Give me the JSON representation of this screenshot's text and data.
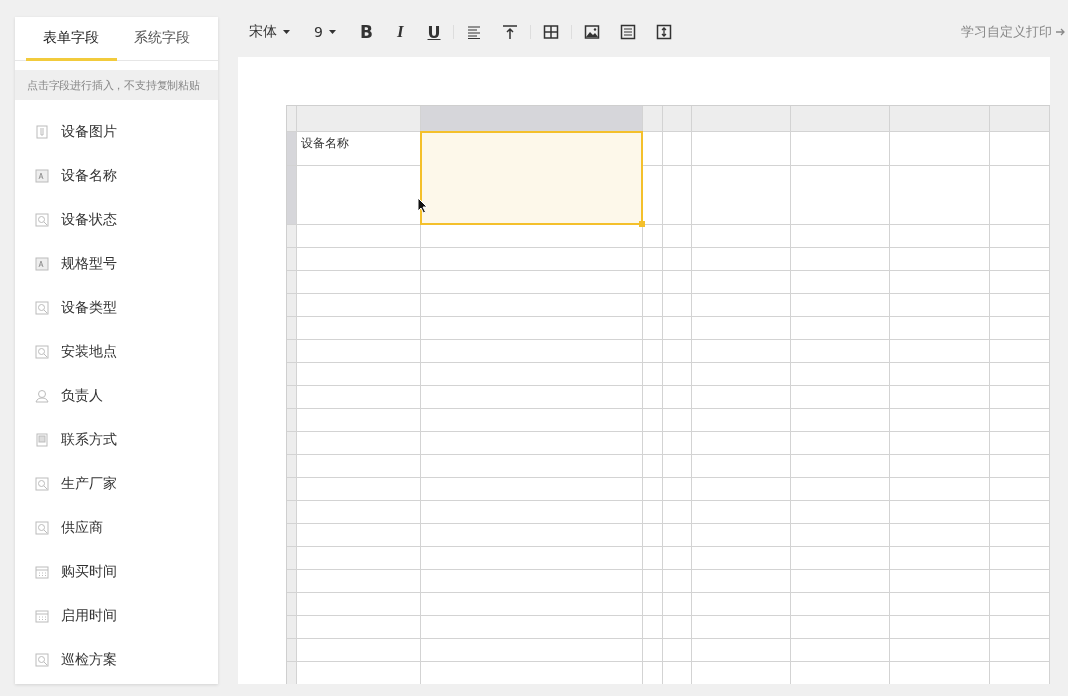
{
  "sidebar": {
    "tabs": [
      {
        "label": "表单字段",
        "selected": true
      },
      {
        "label": "系统字段",
        "selected": false
      }
    ],
    "hint": "点击字段进行插入，不支持复制粘贴",
    "items": [
      {
        "label": "设备图片",
        "kind": "file"
      },
      {
        "label": "设备名称",
        "kind": "text"
      },
      {
        "label": "设备状态",
        "kind": "lookup"
      },
      {
        "label": "规格型号",
        "kind": "text"
      },
      {
        "label": "设备类型",
        "kind": "lookup"
      },
      {
        "label": "安装地点",
        "kind": "lookup"
      },
      {
        "label": "负责人",
        "kind": "user"
      },
      {
        "label": "联系方式",
        "kind": "phone"
      },
      {
        "label": "生产厂家",
        "kind": "lookup"
      },
      {
        "label": "供应商",
        "kind": "lookup"
      },
      {
        "label": "购买时间",
        "kind": "date"
      },
      {
        "label": "启用时间",
        "kind": "date"
      },
      {
        "label": "巡检方案",
        "kind": "lookup"
      }
    ]
  },
  "toolbar": {
    "font": "宋体",
    "size": "9",
    "bold": "B",
    "italic": "I",
    "underline": "U",
    "link": "学习自定义打印"
  },
  "sheet": {
    "cells": [
      {
        "text": "设备名称",
        "selected": false
      },
      {
        "selected": true
      }
    ]
  }
}
